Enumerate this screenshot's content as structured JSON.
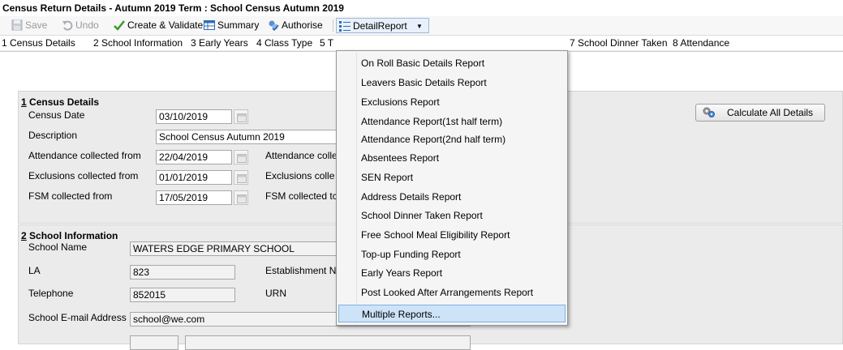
{
  "window": {
    "title": "Census Return Details - Autumn 2019 Term : School Census Autumn 2019"
  },
  "toolbar": {
    "save": "Save",
    "undo": "Undo",
    "create_validate": "Create & Validate",
    "summary": "Summary",
    "authorise": "Authorise",
    "detail_report": "DetailReport"
  },
  "tabs": [
    "1 Census Details",
    "2 School Information",
    "3 Early Years",
    "4 Class Type",
    "5 T",
    "7 School Dinner Taken",
    "8 Attendance"
  ],
  "census_details": {
    "heading_num": "1",
    "heading_text": " Census Details",
    "census_date_label": "Census Date",
    "census_date": "03/10/2019",
    "description_label": "Description",
    "description": "School Census Autumn 2019",
    "attendance_from_label": "Attendance collected from",
    "attendance_from": "22/04/2019",
    "attendance_to_label": "Attendance colle",
    "exclusions_from_label": "Exclusions collected from",
    "exclusions_from": "01/01/2019",
    "exclusions_to_label": "Exclusions colle",
    "fsm_from_label": "FSM collected from",
    "fsm_from": "17/05/2019",
    "fsm_to_label": "FSM collected tc",
    "calculate_all": "Calculate All Details"
  },
  "school_info": {
    "heading_num": "2",
    "heading_text": " School Information",
    "school_name_label": "School Name",
    "school_name": "WATERS EDGE PRIMARY SCHOOL",
    "la_label": "LA",
    "la": "823",
    "establishment_label": "Establishment N",
    "telephone_label": "Telephone",
    "telephone": "852015",
    "urn_label": "URN",
    "email_label": "School E-mail Address",
    "email": "school@we.com"
  },
  "detail_report_menu": [
    "On Roll Basic Details Report",
    "Leavers Basic Details Report",
    "Exclusions Report",
    "Attendance Report(1st half term)",
    "Attendance Report(2nd half term)",
    "Absentees Report",
    "SEN Report",
    "Address Details Report",
    "School Dinner Taken Report",
    "Free School Meal Eligibility Report",
    "Top-up Funding Report",
    "Early Years Report",
    "Post Looked After Arrangements Report",
    "Multiple Reports..."
  ],
  "colors": {
    "menu_highlight": "#cde3f7",
    "accent": "#2b78d0"
  }
}
